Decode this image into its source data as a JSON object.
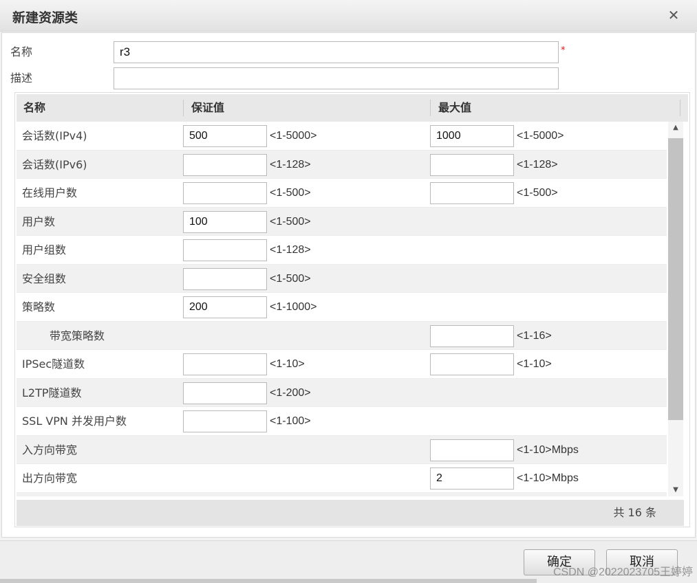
{
  "dialog": {
    "title": "新建资源类",
    "close_icon": "close-icon"
  },
  "form": {
    "name_label": "名称",
    "name_value": "r3",
    "required_mark": "*",
    "desc_label": "描述",
    "desc_value": ""
  },
  "table": {
    "headers": [
      "名称",
      "保证值",
      "最大值"
    ],
    "rows": [
      {
        "name": "会话数(IPv4)",
        "guaranteed": "500",
        "guaranteed_range": "<1-5000>",
        "max": "1000",
        "max_range": "<1-5000>",
        "has_guaranteed": true,
        "has_max": true,
        "indent": false
      },
      {
        "name": "会话数(IPv6)",
        "guaranteed": "",
        "guaranteed_range": "<1-128>",
        "max": "",
        "max_range": "<1-128>",
        "has_guaranteed": true,
        "has_max": true,
        "indent": false
      },
      {
        "name": "在线用户数",
        "guaranteed": "",
        "guaranteed_range": "<1-500>",
        "max": "",
        "max_range": "<1-500>",
        "has_guaranteed": true,
        "has_max": true,
        "indent": false
      },
      {
        "name": "用户数",
        "guaranteed": "100",
        "guaranteed_range": "<1-500>",
        "max": "",
        "max_range": "",
        "has_guaranteed": true,
        "has_max": false,
        "indent": false
      },
      {
        "name": "用户组数",
        "guaranteed": "",
        "guaranteed_range": "<1-128>",
        "max": "",
        "max_range": "",
        "has_guaranteed": true,
        "has_max": false,
        "indent": false
      },
      {
        "name": "安全组数",
        "guaranteed": "",
        "guaranteed_range": "<1-500>",
        "max": "",
        "max_range": "",
        "has_guaranteed": true,
        "has_max": false,
        "indent": false
      },
      {
        "name": "策略数",
        "guaranteed": "200",
        "guaranteed_range": "<1-1000>",
        "max": "",
        "max_range": "",
        "has_guaranteed": true,
        "has_max": false,
        "indent": false
      },
      {
        "name": "带宽策略数",
        "guaranteed": "",
        "guaranteed_range": "",
        "max": "",
        "max_range": "<1-16>",
        "has_guaranteed": false,
        "has_max": true,
        "indent": true
      },
      {
        "name": "IPSec隧道数",
        "guaranteed": "",
        "guaranteed_range": "<1-10>",
        "max": "",
        "max_range": "<1-10>",
        "has_guaranteed": true,
        "has_max": true,
        "indent": false
      },
      {
        "name": "L2TP隧道数",
        "guaranteed": "",
        "guaranteed_range": "<1-200>",
        "max": "",
        "max_range": "",
        "has_guaranteed": true,
        "has_max": false,
        "indent": false
      },
      {
        "name": "SSL VPN 并发用户数",
        "guaranteed": "",
        "guaranteed_range": "<1-100>",
        "max": "",
        "max_range": "",
        "has_guaranteed": true,
        "has_max": false,
        "indent": false
      },
      {
        "name": "入方向带宽",
        "guaranteed": "",
        "guaranteed_range": "",
        "max": "",
        "max_range": "<1-10>Mbps",
        "has_guaranteed": false,
        "has_max": true,
        "indent": false
      },
      {
        "name": "出方向带宽",
        "guaranteed": "",
        "guaranteed_range": "",
        "max": "2",
        "max_range": "<1-10>Mbps",
        "has_guaranteed": false,
        "has_max": true,
        "indent": false
      },
      {
        "name": "",
        "guaranteed": "",
        "guaranteed_range": "",
        "max": "",
        "max_range": "",
        "has_guaranteed": false,
        "has_max": true,
        "indent": false
      }
    ],
    "total_label": "共 16 条"
  },
  "footer": {
    "ok_label": "确定",
    "cancel_label": "取消"
  },
  "watermark": "CSDN @2022023705王婷婷"
}
